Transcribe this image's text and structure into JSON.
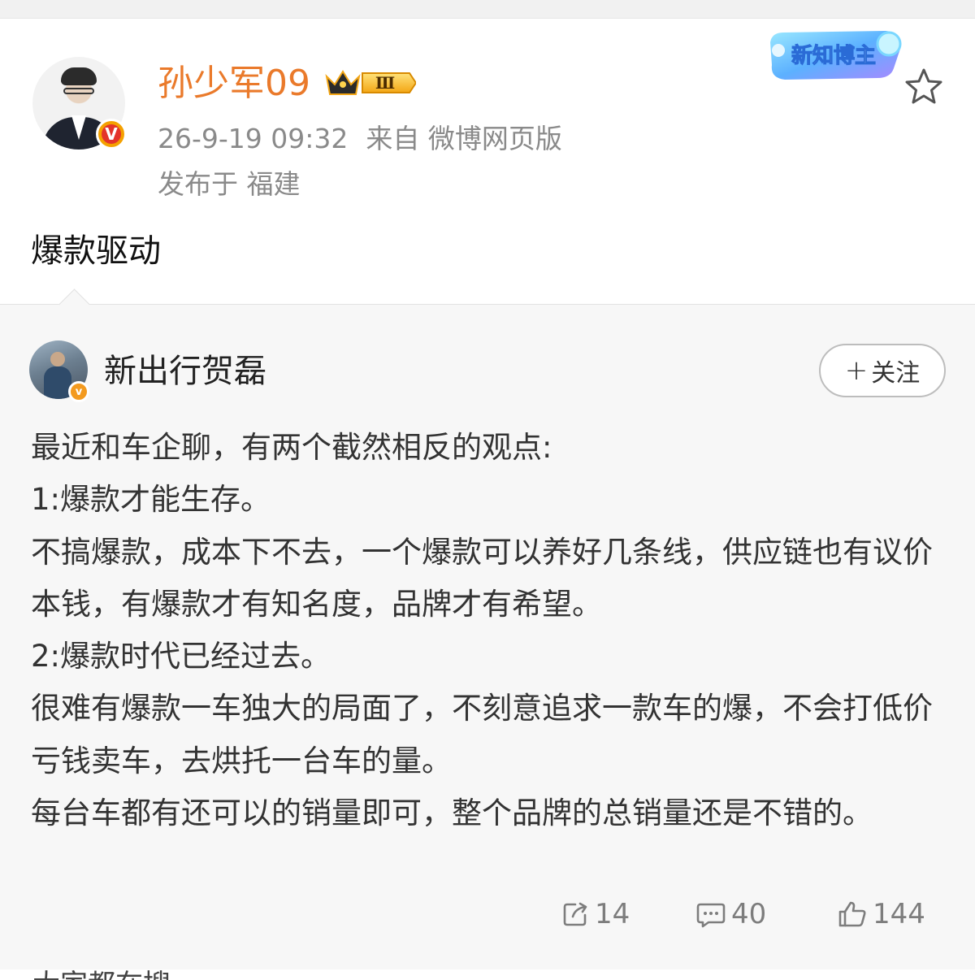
{
  "post": {
    "author": "孙少军09",
    "level": "Ⅲ",
    "time": "26-9-19 09:32",
    "source": "来自 微博网页版",
    "location": "发布于 福建",
    "badge_text": "新知博主",
    "text": "爆款驱动",
    "verified_mark": "V"
  },
  "repost": {
    "author": "新出行贺磊",
    "follow_plus": "+",
    "follow_label": "关注",
    "paragraphs": [
      "最近和车企聊，有两个截然相反的观点:",
      "1:爆款才能生存。",
      "不搞爆款，成本下不去，一个爆款可以养好几条线，供应链也有议价本钱，有爆款才有知名度，品牌才有希望。",
      "2:爆款时代已经过去。",
      "很难有爆款一车独大的局面了，不刻意追求一款车的爆，不会打低价亏钱卖车，去烘托一台车的量。",
      "每台车都有还可以的销量即可，整个品牌的总销量还是不错的。"
    ],
    "shares": "14",
    "comments": "40",
    "likes": "144",
    "verified_mark": "v"
  },
  "next_comment_partial": "大家都在搜"
}
